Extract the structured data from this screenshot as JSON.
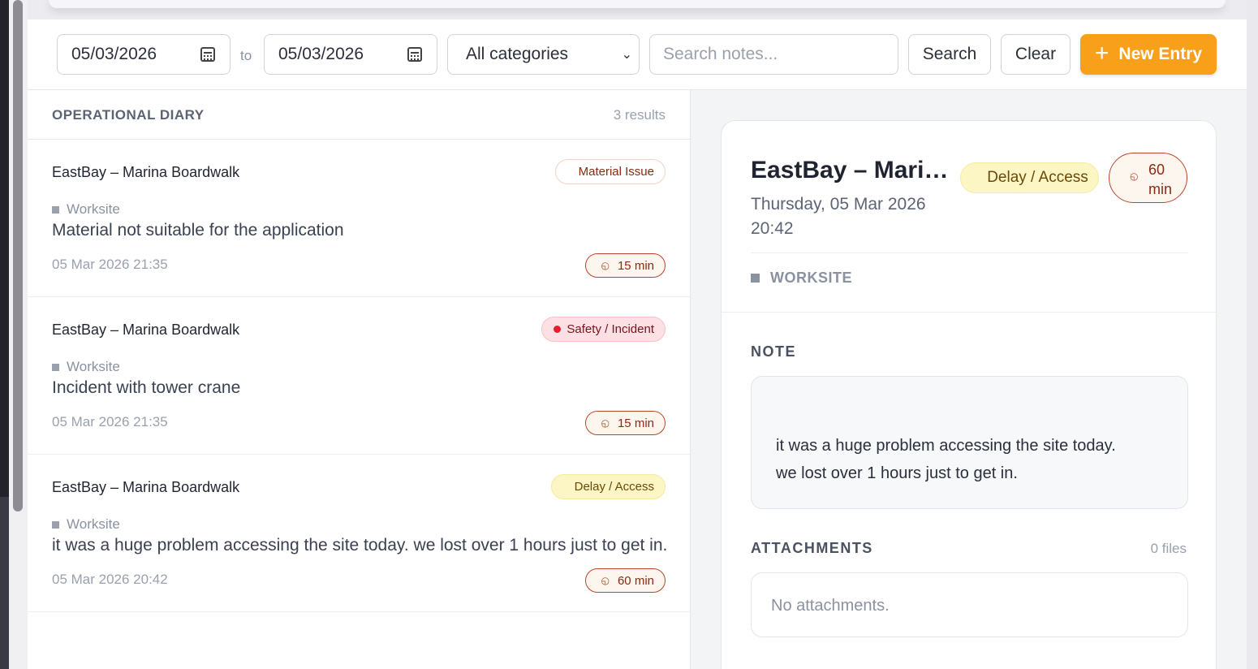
{
  "filters": {
    "date_from": "05/03/2026",
    "date_to": "05/03/2026",
    "to_label": "to",
    "category": "All categories",
    "search_placeholder": "Search notes...",
    "search_label": "Search",
    "clear_label": "Clear",
    "new_entry_label": "New Entry"
  },
  "list": {
    "title": "OPERATIONAL DIARY",
    "count": "3 results",
    "entries": [
      {
        "title": "EastBay – Marina Boardwalk",
        "category": "Material Issue",
        "tag": "Worksite",
        "note": "Material not suitable for the application",
        "time": "05 Mar 2026 21:35",
        "duration": "15 min"
      },
      {
        "title": "EastBay – Marina Boardwalk",
        "category": "Safety / Incident",
        "tag": "Worksite",
        "note": "Incident with tower crane",
        "time": "05 Mar 2026 21:35",
        "duration": "15 min"
      },
      {
        "title": "EastBay – Marina Boardwalk",
        "category": "Delay / Access",
        "tag": "Worksite",
        "note": "it was a huge problem accessing the site today. we lost over 1 hours just to get in.",
        "time": "05 Mar 2026 20:42",
        "duration": "60 min"
      }
    ]
  },
  "detail": {
    "title": "EastBay – Marina Boardwalk",
    "date": "Thursday, 05 Mar 2026 20:42",
    "category": "Delay / Access",
    "duration": "60 min",
    "worksite": "WORKSITE",
    "note_label": "NOTE",
    "note_line1": "it was a huge problem accessing the site today.",
    "note_line2": "we lost over 1 hours just to get in.",
    "attachments_label": "ATTACHMENTS",
    "attachments_count": "0 files",
    "attachments_empty": "No attachments."
  },
  "colors": {
    "accent": "#f9a01b",
    "safety_dot": "#e02030",
    "duration_border": "#b8462a",
    "delay_bg": "#fbf6c4"
  },
  "icons": [
    "calendar-icon",
    "chevron-down-icon",
    "plus-icon",
    "clock-icon",
    "square-icon"
  ]
}
